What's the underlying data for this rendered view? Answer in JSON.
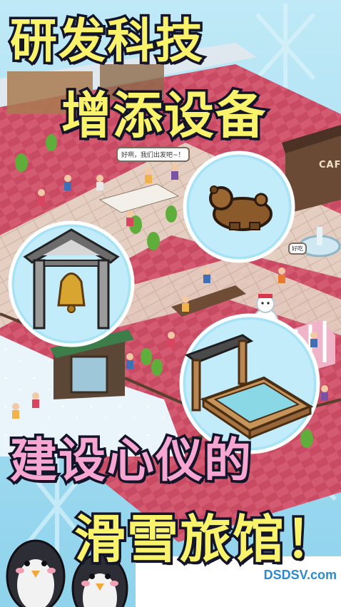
{
  "headline": {
    "line1": "研发科技",
    "line2": "增添设备",
    "line3": "建设心仪的",
    "line4": "滑雪旅馆！"
  },
  "speech_bubbles": {
    "bubble1": "好咧，我们出发吧~！",
    "bubble2": "好吃"
  },
  "sign": {
    "cafe": "CAF"
  },
  "watermark": {
    "brand": "DSDSV",
    "suffix": ".com"
  },
  "featured_items": {
    "item1": "bear-plush-icon",
    "item2": "bell-gate-icon",
    "item3": "hot-spring-bath-icon"
  },
  "colors": {
    "headline_yellow": "#f8f36a",
    "headline_green": "#b7f34a",
    "headline_pink": "#f7a6d2",
    "outline": "#15152a",
    "carpet": "#c94a63",
    "sky": "#9fd9ee",
    "watermark_blue": "#2b8ad0"
  }
}
